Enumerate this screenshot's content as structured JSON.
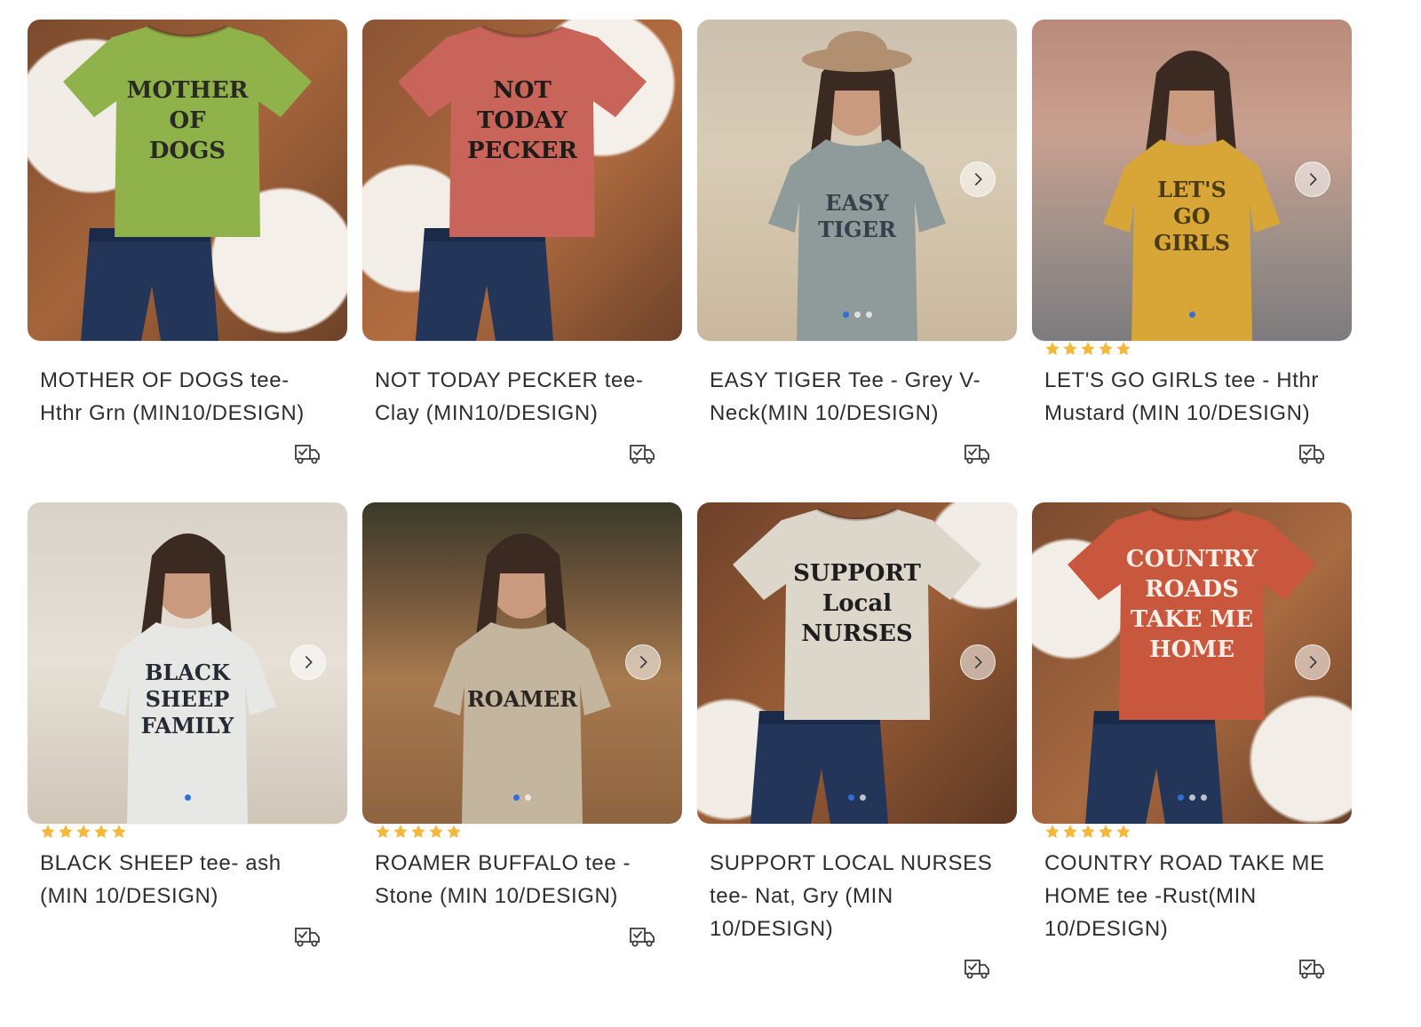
{
  "colors": {
    "star": "#f5b83d",
    "dot_active": "#2f6fd6",
    "text": "#2e2e2e"
  },
  "products": [
    {
      "title": "MOTHER OF DOGS tee- Hthr Grn (MIN10/DESIGN)",
      "rating": 0,
      "shirt_color": "#8fb24a",
      "shirt_text": [
        "MOTHER",
        "OF",
        "DOGS"
      ],
      "has_next_button": false,
      "dots": 0,
      "active_dot": -1,
      "icon": "free-shipping-truck-icon"
    },
    {
      "title": "NOT TODAY PECKER tee- Clay (MIN10/DESIGN)",
      "rating": 0,
      "shirt_color": "#c9645a",
      "shirt_text": [
        "NOT",
        "TODAY",
        "PECKER"
      ],
      "has_next_button": false,
      "dots": 0,
      "active_dot": -1,
      "icon": "free-shipping-truck-icon"
    },
    {
      "title": "EASY TIGER Tee - Grey V-Neck(MIN 10/DESIGN)",
      "rating": 0,
      "shirt_color": "#8f9a9a",
      "shirt_text": [
        "EASY",
        "TIGER"
      ],
      "has_next_button": true,
      "dots": 3,
      "active_dot": 0,
      "icon": "free-shipping-truck-icon"
    },
    {
      "title": "LET'S GO GIRLS tee - Hthr Mustard (MIN 10/DESIGN)",
      "rating": 5,
      "shirt_color": "#d7a637",
      "shirt_text": [
        "LET'S",
        "GO",
        "GIRLS"
      ],
      "has_next_button": true,
      "dots": 1,
      "active_dot": 0,
      "icon": "free-shipping-truck-icon"
    },
    {
      "title": "BLACK SHEEP tee- ash (MIN 10/DESIGN)",
      "rating": 5,
      "shirt_color": "#e7e7e5",
      "shirt_text": [
        "BLACK",
        "SHEEP",
        "FAMILY"
      ],
      "has_next_button": true,
      "dots": 1,
      "active_dot": 0,
      "icon": "free-shipping-truck-icon"
    },
    {
      "title": "ROAMER BUFFALO tee - Stone (MIN 10/DESIGN)",
      "rating": 5,
      "shirt_color": "#c3b59e",
      "shirt_text": [
        "ROAMER"
      ],
      "has_next_button": true,
      "dots": 2,
      "active_dot": 0,
      "icon": "free-shipping-truck-icon"
    },
    {
      "title": "SUPPORT LOCAL NURSES tee- Nat, Gry (MIN 10/DESIGN)",
      "rating": 0,
      "shirt_color": "#dcd6cb",
      "shirt_text": [
        "SUPPORT",
        "Local",
        "NURSES"
      ],
      "has_next_button": true,
      "dots": 2,
      "active_dot": 0,
      "icon": "free-shipping-truck-icon"
    },
    {
      "title": "COUNTRY ROAD TAKE ME HOME tee -Rust(MIN 10/DESIGN)",
      "rating": 5,
      "shirt_color": "#c8573d",
      "shirt_text": [
        "COUNTRY",
        "ROADS",
        "TAKE ME",
        "HOME"
      ],
      "has_next_button": true,
      "dots": 3,
      "active_dot": 0,
      "icon": "free-shipping-truck-icon"
    }
  ]
}
